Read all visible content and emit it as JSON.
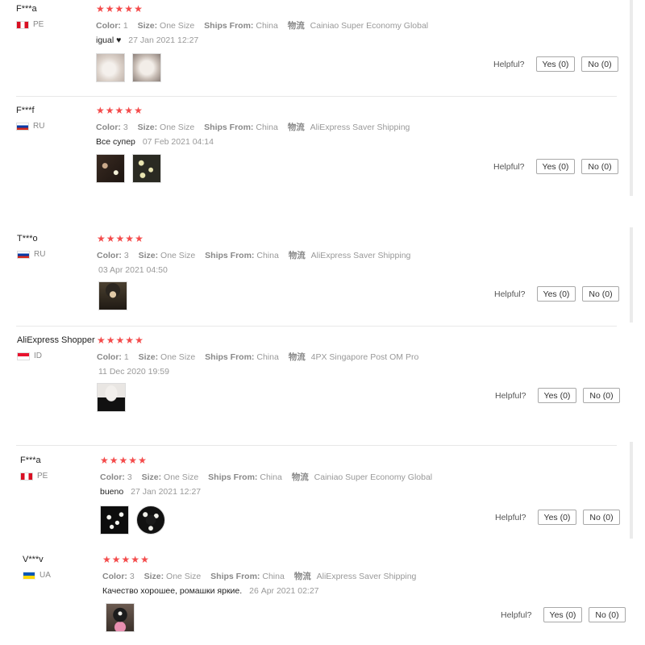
{
  "labels": {
    "color": "Color:",
    "size": "Size:",
    "ships_from": "Ships From:",
    "logistics": "物流",
    "helpful": "Helpful?"
  },
  "colors": {
    "star": "#f44b4b",
    "divider": "#e8e8e8",
    "button_border": "#a9a9a9"
  },
  "reviews": [
    {
      "user": "F***a",
      "country": "PE",
      "flag_icon": "peru-flag-icon",
      "rating": 5,
      "color": "1",
      "size": "One Size",
      "ships_from": "China",
      "logistics": "Cainiao Super Economy Global",
      "comment": "igual ♥",
      "date": "27 Jan 2021 12:27",
      "yes": "Yes (0)",
      "no": "No (0)"
    },
    {
      "user": "F***f",
      "country": "RU",
      "flag_icon": "russia-flag-icon",
      "rating": 5,
      "color": "3",
      "size": "One Size",
      "ships_from": "China",
      "logistics": "AliExpress Saver Shipping",
      "comment": "Все супер",
      "date": "07 Feb 2021 04:14",
      "yes": "Yes (0)",
      "no": "No (0)"
    },
    {
      "user": "T***o",
      "country": "RU",
      "flag_icon": "russia-flag-icon",
      "rating": 5,
      "color": "3",
      "size": "One Size",
      "ships_from": "China",
      "logistics": "AliExpress Saver Shipping",
      "comment": "",
      "date": "03 Apr 2021 04:50",
      "yes": "Yes (0)",
      "no": "No (0)"
    },
    {
      "user": "AliExpress Shopper",
      "country": "ID",
      "flag_icon": "indonesia-flag-icon",
      "rating": 5,
      "color": "1",
      "size": "One Size",
      "ships_from": "China",
      "logistics": "4PX Singapore Post OM Pro",
      "comment": "",
      "date": "11 Dec 2020 19:59",
      "yes": "Yes (0)",
      "no": "No (0)"
    },
    {
      "user": "F***a",
      "country": "PE",
      "flag_icon": "peru-flag-icon",
      "rating": 5,
      "color": "3",
      "size": "One Size",
      "ships_from": "China",
      "logistics": "Cainiao Super Economy Global",
      "comment": "bueno",
      "date": "27 Jan 2021 12:27",
      "yes": "Yes (0)",
      "no": "No (0)"
    },
    {
      "user": "V***v",
      "country": "UA",
      "flag_icon": "ukraine-flag-icon",
      "rating": 5,
      "color": "3",
      "size": "One Size",
      "ships_from": "China",
      "logistics": "AliExpress Saver Shipping",
      "comment": "Качество хорошее, ромашки яркие.",
      "date": "26 Apr 2021 02:27",
      "yes": "Yes (0)",
      "no": "No (0)"
    }
  ]
}
